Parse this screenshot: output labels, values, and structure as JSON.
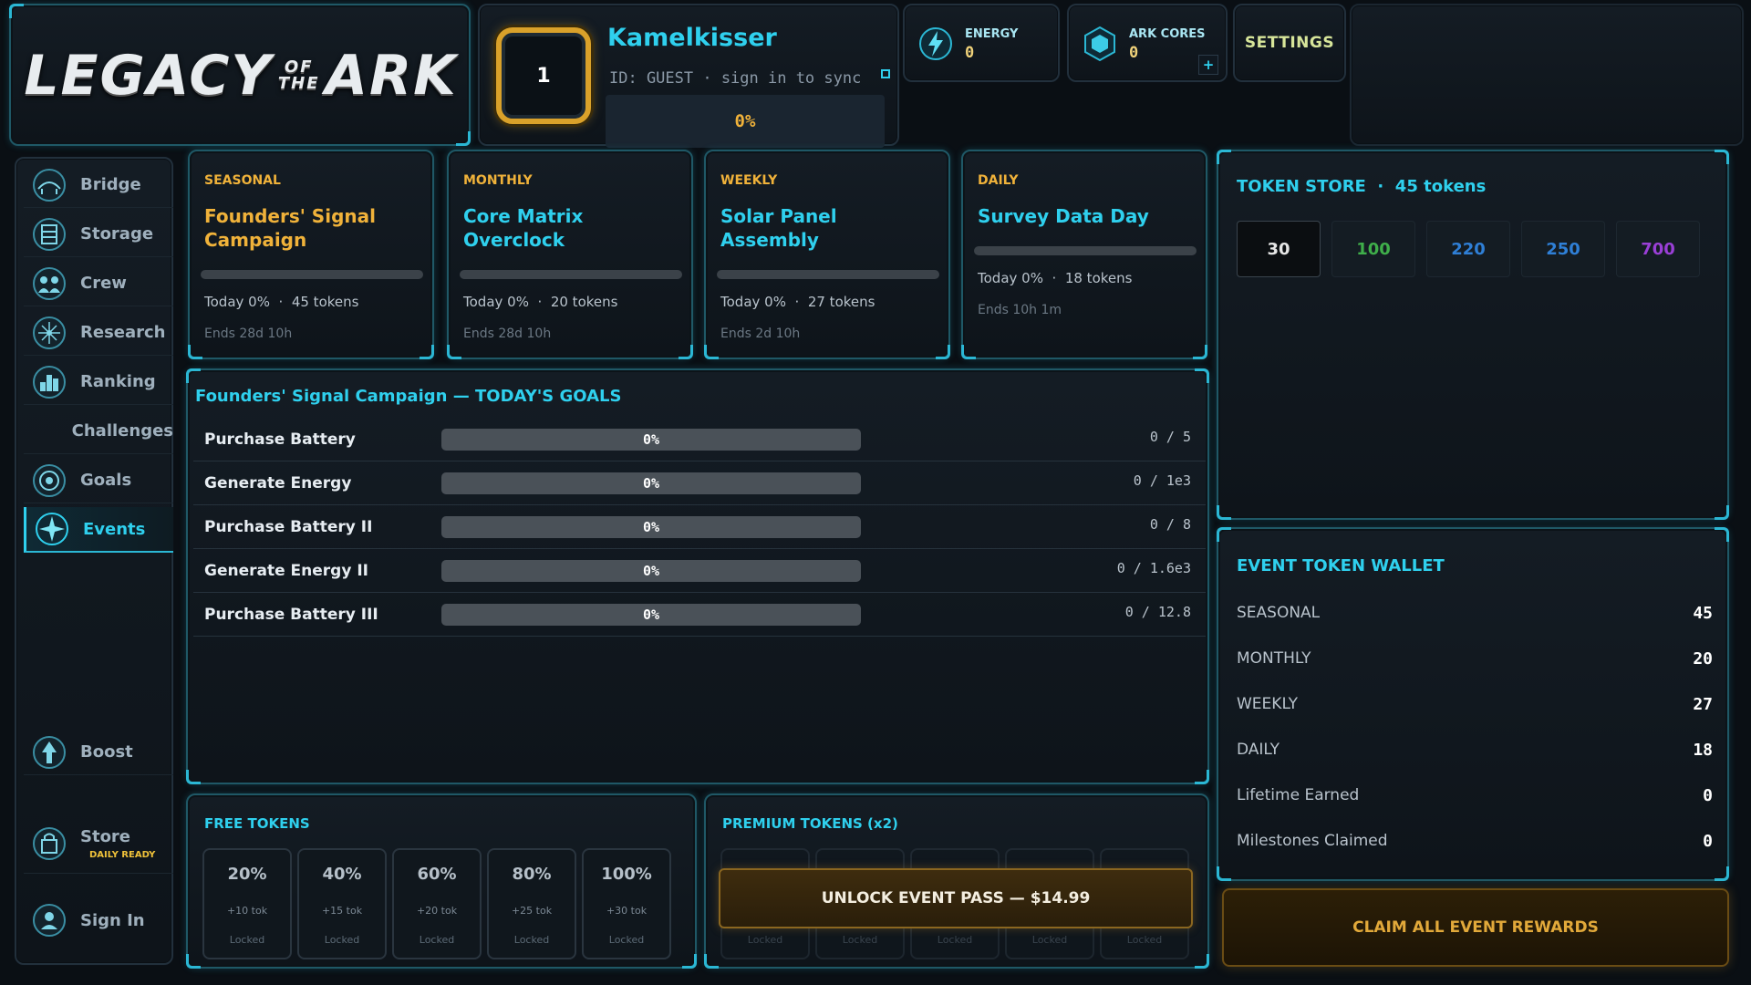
{
  "logo": {
    "part1": "LEGACY",
    "of": "OF",
    "the": "THE",
    "part2": "ARK"
  },
  "profile": {
    "level": "1",
    "name": "Kamelkisser",
    "id_text": "ID: GUEST · sign in to sync",
    "xp_text": "0%",
    "xp_progress": 0
  },
  "currencies": {
    "energy": {
      "label": "ENERGY",
      "value": "0",
      "icon": "lightning-icon"
    },
    "cores": {
      "label": "ARK CORES",
      "value": "0",
      "icon": "hex-core-icon",
      "add_label": "+"
    }
  },
  "settings_label": "SETTINGS",
  "sidebar": {
    "items": [
      {
        "label": "Bridge",
        "icon": "bridge-icon"
      },
      {
        "label": "Storage",
        "icon": "storage-icon"
      },
      {
        "label": "Crew",
        "icon": "crew-icon"
      },
      {
        "label": "Research",
        "icon": "research-icon"
      },
      {
        "label": "Ranking",
        "icon": "ranking-icon"
      },
      {
        "label": "Challenges",
        "icon": ""
      },
      {
        "label": "Goals",
        "icon": "goals-icon"
      },
      {
        "label": "Events",
        "icon": "events-icon",
        "active": true
      },
      {
        "label": "Boost",
        "icon": "boost-icon"
      },
      {
        "label": "Store",
        "icon": "store-icon",
        "sub": "DAILY READY"
      },
      {
        "label": "Sign In",
        "icon": "sign-in-icon"
      }
    ]
  },
  "events": [
    {
      "category": "SEASONAL",
      "title": "Founders' Signal Campaign",
      "today": "Today 0%",
      "sep": "·",
      "tokens": "45 tokens",
      "ends": "Ends 28d 10h",
      "progress": 0,
      "title_color": "#f0b23a"
    },
    {
      "category": "MONTHLY",
      "title": "Core Matrix Overclock",
      "today": "Today 0%",
      "sep": "·",
      "tokens": "20 tokens",
      "ends": "Ends 28d 10h",
      "progress": 0,
      "title_color": "#2fd0ee"
    },
    {
      "category": "WEEKLY",
      "title": "Solar Panel Assembly",
      "today": "Today 0%",
      "sep": "·",
      "tokens": "27 tokens",
      "ends": "Ends 2d 10h",
      "progress": 0,
      "title_color": "#2fd0ee"
    },
    {
      "category": "DAILY",
      "title": "Survey Data Day",
      "today": "Today 0%",
      "sep": "·",
      "tokens": "18 tokens",
      "ends": "Ends 10h 1m",
      "progress": 0,
      "title_color": "#2fd0ee"
    }
  ],
  "goals": {
    "title": "Founders' Signal Campaign — TODAY'S GOALS",
    "rows": [
      {
        "name": "Purchase Battery",
        "pct": "0%",
        "progress": "0 / 5"
      },
      {
        "name": "Generate Energy",
        "pct": "0%",
        "progress": "0 / 1e3"
      },
      {
        "name": "Purchase Battery II",
        "pct": "0%",
        "progress": "0 / 8"
      },
      {
        "name": "Generate Energy II",
        "pct": "0%",
        "progress": "0 / 1.6e3"
      },
      {
        "name": "Purchase Battery III",
        "pct": "0%",
        "progress": "0 / 12.8"
      }
    ]
  },
  "free_tokens": {
    "title": "FREE TOKENS",
    "tiers": [
      {
        "pct": "20%",
        "tok": "+10 tok",
        "status": "Locked"
      },
      {
        "pct": "40%",
        "tok": "+15 tok",
        "status": "Locked"
      },
      {
        "pct": "60%",
        "tok": "+20 tok",
        "status": "Locked"
      },
      {
        "pct": "80%",
        "tok": "+25 tok",
        "status": "Locked"
      },
      {
        "pct": "100%",
        "tok": "+30 tok",
        "status": "Locked"
      }
    ]
  },
  "premium_tokens": {
    "title": "PREMIUM TOKENS (x2)",
    "tier_status": [
      "Locked",
      "Locked",
      "Locked",
      "Locked",
      "Locked"
    ],
    "unlock_label": "UNLOCK EVENT PASS — $14.99"
  },
  "token_store": {
    "title": "TOKEN STORE",
    "sep": "·",
    "count": "45 tokens",
    "packs": [
      {
        "label": "30",
        "color": "#e6e6e6",
        "selected": true
      },
      {
        "label": "100",
        "color": "#3fae4a"
      },
      {
        "label": "220",
        "color": "#2f7fd6"
      },
      {
        "label": "250",
        "color": "#2f7fd6"
      },
      {
        "label": "700",
        "color": "#9a3fd6"
      }
    ]
  },
  "wallet": {
    "title": "EVENT TOKEN WALLET",
    "rows": [
      {
        "label": "SEASONAL",
        "value": "45"
      },
      {
        "label": "MONTHLY",
        "value": "20"
      },
      {
        "label": "WEEKLY",
        "value": "27"
      },
      {
        "label": "DAILY",
        "value": "18"
      },
      {
        "label": "Lifetime Earned",
        "value": "0"
      },
      {
        "label": "Milestones Claimed",
        "value": "0"
      }
    ]
  },
  "claim_label": "CLAIM ALL EVENT REWARDS",
  "colors": {
    "accent": "#2fd0ee",
    "gold": "#f0b23a",
    "background": "#0a0f14"
  }
}
